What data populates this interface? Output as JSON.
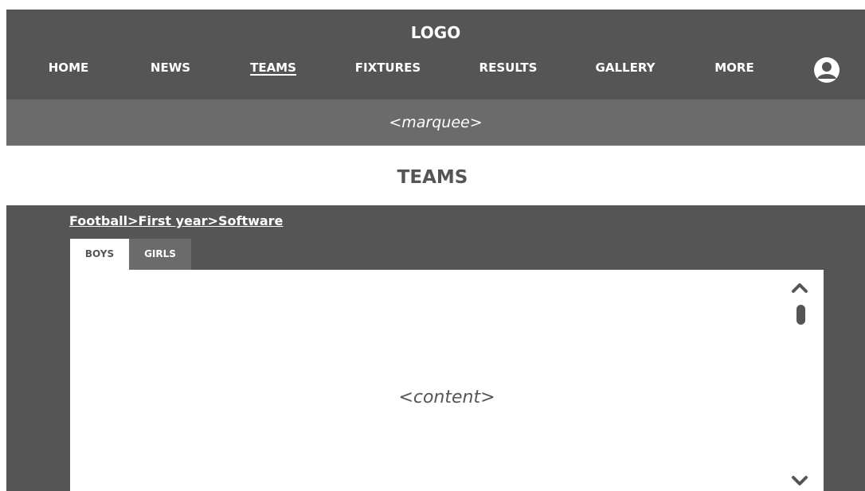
{
  "header": {
    "logo": "LOGO",
    "nav": [
      {
        "label": "HOME"
      },
      {
        "label": "NEWS"
      },
      {
        "label": "TEAMS",
        "active": true
      },
      {
        "label": "FIXTURES"
      },
      {
        "label": "RESULTS"
      },
      {
        "label": "GALLERY"
      },
      {
        "label": "MORE"
      }
    ],
    "account_icon": "user-account-icon"
  },
  "marquee": {
    "text": "<marquee>"
  },
  "page": {
    "title": "TEAMS"
  },
  "panel": {
    "breadcrumb": "Football>First year>Software",
    "tabs": [
      {
        "label": "BOYS",
        "active": true
      },
      {
        "label": "GIRLS",
        "active": false
      }
    ],
    "content": "<content>"
  },
  "colors": {
    "header_bg": "#555555",
    "marquee_bg": "#6b6b6b",
    "text_light": "#ffffff",
    "text_dark": "#555555"
  }
}
